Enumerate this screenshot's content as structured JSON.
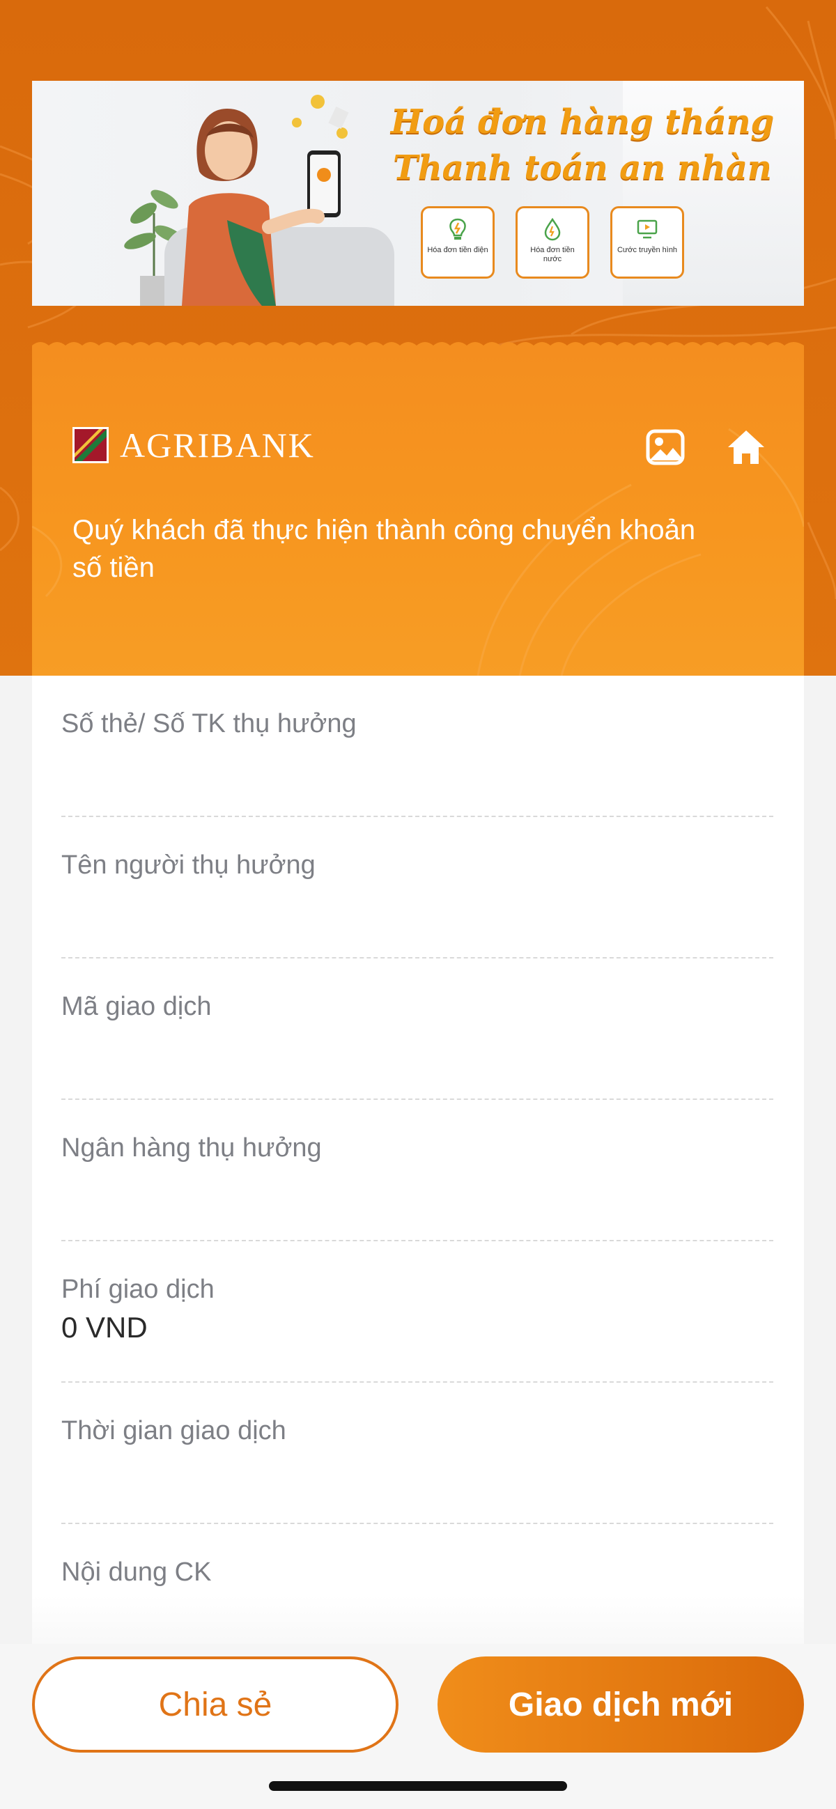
{
  "banner": {
    "headline_line1": "Hoá đơn hàng tháng",
    "headline_line2": "Thanh toán an nhàn",
    "tiles": [
      {
        "label": "Hóa đơn tiền điện",
        "icon": "bulb-icon"
      },
      {
        "label": "Hóa đơn tiền nước",
        "icon": "water-drop-icon"
      },
      {
        "label": "Cước truyền hình",
        "icon": "tv-icon"
      }
    ]
  },
  "header": {
    "brand": "AGRIBANK",
    "success_message": "Quý khách đã thực hiện thành công chuyển khoản số tiền"
  },
  "details": [
    {
      "label": "Số thẻ/ Số TK thụ hưởng",
      "value": ""
    },
    {
      "label": "Tên người thụ hưởng",
      "value": ""
    },
    {
      "label": "Mã giao dịch",
      "value": ""
    },
    {
      "label": "Ngân hàng thụ hưởng",
      "value": ""
    },
    {
      "label": "Phí giao dịch",
      "value": "0 VND"
    },
    {
      "label": "Thời gian giao dịch",
      "value": ""
    },
    {
      "label": "Nội dung CK",
      "value": ""
    }
  ],
  "actions": {
    "share_label": "Chia sẻ",
    "new_transaction_label": "Giao dịch mới"
  },
  "colors": {
    "brand_orange": "#f48e1f",
    "dark_orange": "#d96a0c",
    "button_outline": "#e07417"
  }
}
